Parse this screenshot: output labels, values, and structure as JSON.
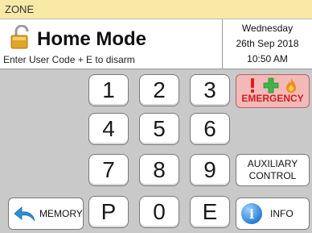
{
  "zone_label": "ZONE",
  "mode": {
    "title": "Home Mode",
    "hint": "Enter User Code + E to disarm"
  },
  "datetime": {
    "day": "Wednesday",
    "date": "26th Sep 2018",
    "time": "10:50 AM"
  },
  "keypad": {
    "k1": "1",
    "k2": "2",
    "k3": "3",
    "k4": "4",
    "k5": "5",
    "k6": "6",
    "k7": "7",
    "k8": "8",
    "k9": "9",
    "kP": "P",
    "k0": "0",
    "kE": "E"
  },
  "buttons": {
    "emergency": "EMERGENCY",
    "auxiliary_line1": "AUXILIARY",
    "auxiliary_line2": "CONTROL",
    "info": "INFO",
    "memory": "MEMORY"
  },
  "icons": {
    "mode": "padlock-icon",
    "emergency": [
      "exclamation-icon",
      "medical-cross-icon",
      "fire-icon"
    ],
    "info": "info-icon",
    "memory": "back-arrow-icon"
  },
  "colors": {
    "zone_bar": "#f8e9a7",
    "emergency_bg": "#f3b9b9",
    "emergency_text": "#cc1f1f",
    "info_blue": "#2a7fd6",
    "arrow_blue": "#2d8fd5"
  }
}
